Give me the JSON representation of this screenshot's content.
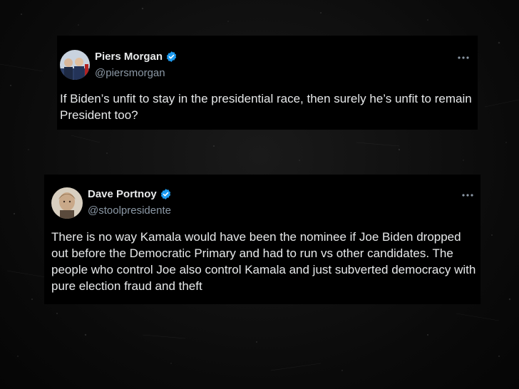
{
  "tweets": [
    {
      "display_name": "Piers Morgan",
      "handle": "@piersmorgan",
      "verified": true,
      "text": "If Biden’s unfit to stay in the presidential race, then surely he’s unfit to remain President too?"
    },
    {
      "display_name": "Dave Portnoy",
      "handle": "@stoolpresidente",
      "verified": true,
      "text": "There is no way Kamala would have been the nominee if Joe Biden dropped out before the Democratic Primary and had to run vs other candidates.  The people who control Joe also control Kamala and just subverted democracy with pure election fraud and theft"
    }
  ],
  "colors": {
    "background": "#0d0d0d",
    "card": "#000000",
    "text": "#e7e9ea",
    "handle": "#8b98a5",
    "verified": "#1d9bf0"
  },
  "icons": {
    "verified": "verified-badge-icon",
    "more": "more-horizontal-icon"
  }
}
